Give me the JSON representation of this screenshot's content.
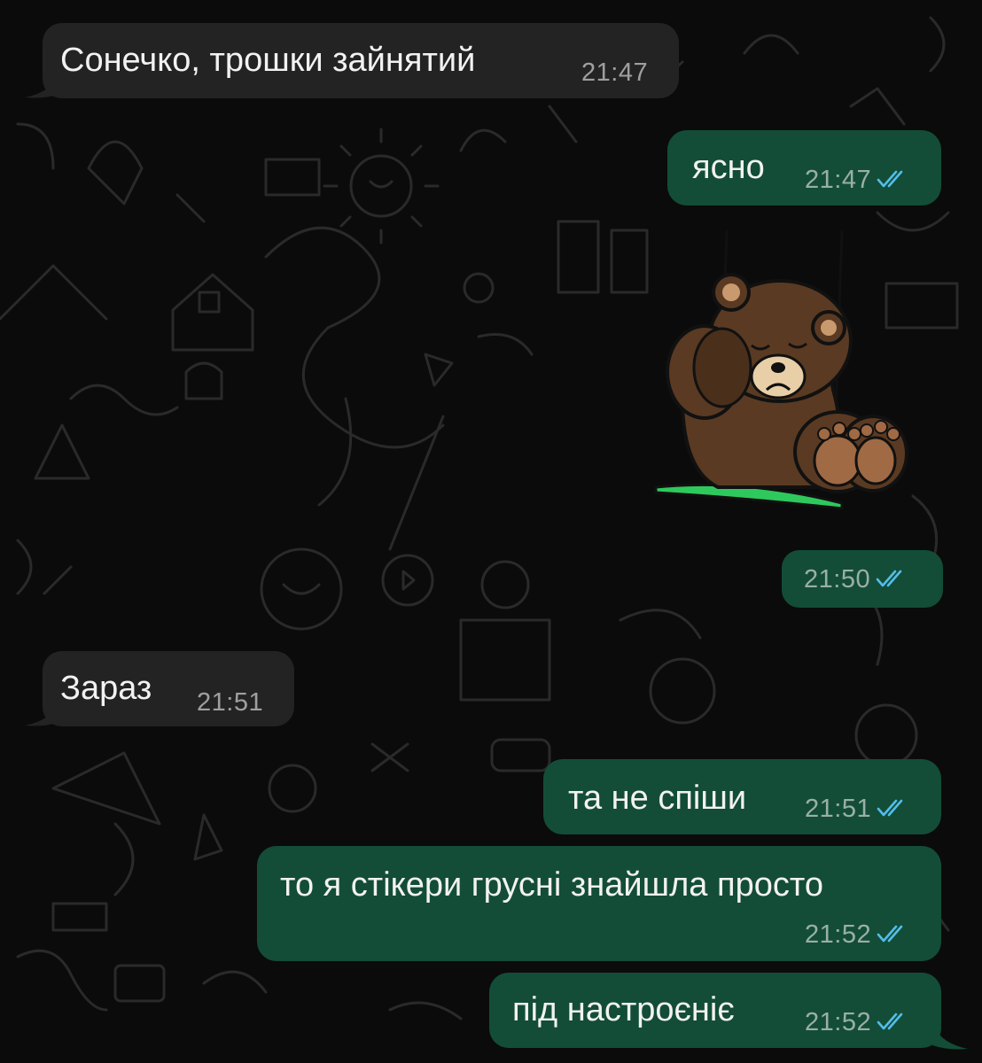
{
  "theme": {
    "incoming_bubble": "#232323",
    "outgoing_bubble": "#134d37",
    "read_tick_color": "#53bdeb",
    "background": "#0b0b0b"
  },
  "messages": [
    {
      "direction": "in",
      "text": "Сонечко, трошки зайнятий",
      "time": "21:47"
    },
    {
      "direction": "out",
      "text": "ясно",
      "time": "21:47",
      "status": "read"
    },
    {
      "direction": "out",
      "type": "sticker",
      "sticker": "sad-bear-on-swing",
      "time": "21:50",
      "status": "read"
    },
    {
      "direction": "in",
      "text": "Зараз",
      "time": "21:51"
    },
    {
      "direction": "out",
      "text": "та не спіши",
      "time": "21:51",
      "status": "read"
    },
    {
      "direction": "out",
      "text": "то я стікери грусні знайшла просто",
      "time": "21:52",
      "status": "read"
    },
    {
      "direction": "out",
      "text": "під настроєніє",
      "time": "21:52",
      "status": "read"
    }
  ]
}
